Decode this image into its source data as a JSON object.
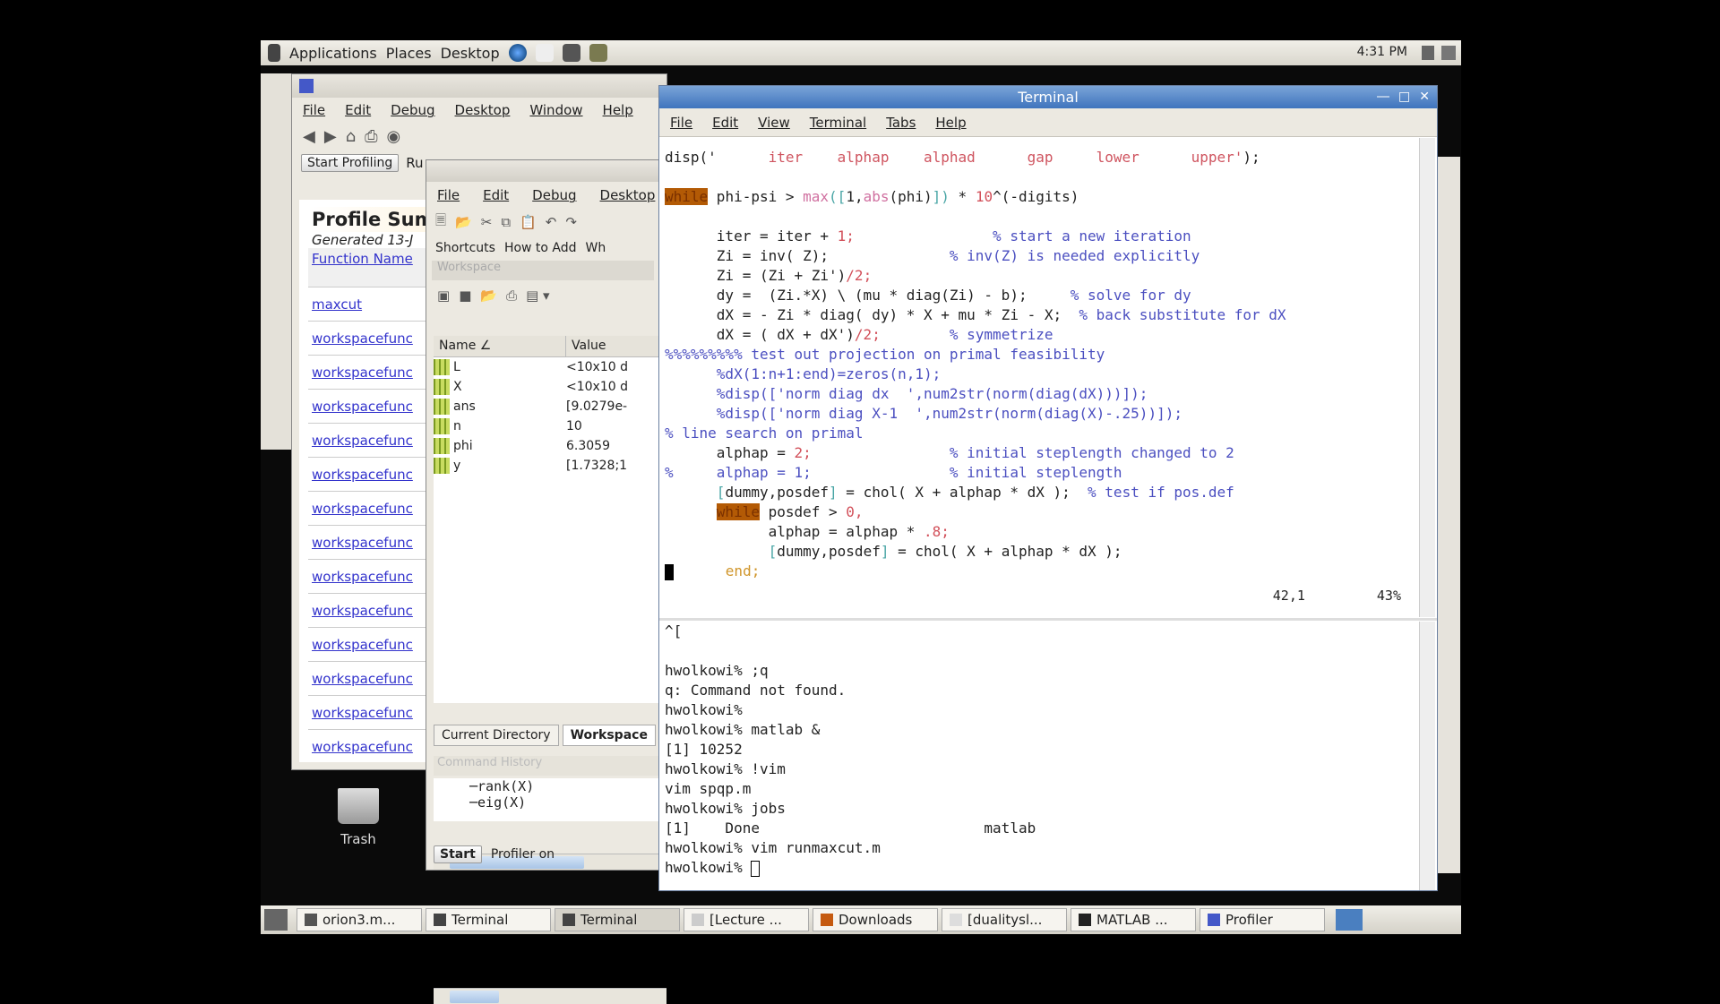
{
  "top_panel": {
    "menus": [
      "Applications",
      "Places",
      "Desktop"
    ],
    "clock": "4:31 PM"
  },
  "profiler": {
    "menu": [
      "File",
      "Edit",
      "Debug",
      "Desktop",
      "Window",
      "Help"
    ],
    "start_button": "Start Profiling",
    "run_label": "Ru",
    "heading": "Profile Sum",
    "generated": "Generated 13-J",
    "column_header": "Function Name",
    "links": [
      "maxcut",
      "workspacefunc",
      "workspacefunc",
      "workspacefunc",
      "workspacefunc",
      "workspacefunc",
      "workspacefunc",
      "workspacefunc",
      "workspacefunc",
      "workspacefunc",
      "workspacefunc",
      "workspacefunc",
      "workspacefunc",
      "workspacefunc"
    ]
  },
  "matlab": {
    "menu": [
      "File",
      "Edit",
      "Debug",
      "Desktop"
    ],
    "shortcuts": [
      "Shortcuts",
      "How to Add",
      "Wh"
    ],
    "workspace_title": "Workspace",
    "columns": [
      "Name ∠",
      "Value"
    ],
    "variables": [
      {
        "name": "L",
        "value": "<10x10 d"
      },
      {
        "name": "X",
        "value": "<10x10 d"
      },
      {
        "name": "ans",
        "value": "[9.0279e-"
      },
      {
        "name": "n",
        "value": "10"
      },
      {
        "name": "phi",
        "value": "6.3059"
      },
      {
        "name": "y",
        "value": "[1.7328;1"
      }
    ],
    "tabs": [
      "Current Directory",
      "Workspace"
    ],
    "history_title": "Command History",
    "history": [
      "─rank(X)",
      "─eig(X)"
    ],
    "start_label": "Start",
    "status": "Profiler on"
  },
  "terminal": {
    "title": "Terminal",
    "menu": [
      "File",
      "Edit",
      "View",
      "Terminal",
      "Tabs",
      "Help"
    ],
    "vim_lines": [
      [
        [
          "disp('      ",
          ""
        ],
        [
          "iter    alphap    alphad      gap     lower      upper'",
          "c-str"
        ],
        [
          ");",
          ""
        ]
      ],
      [],
      [
        [
          "while",
          "c-kw"
        ],
        [
          " phi-psi > ",
          ""
        ],
        [
          "max",
          "c-fn"
        ],
        [
          "([",
          "c-br"
        ],
        [
          "1,",
          ""
        ],
        [
          "abs",
          "c-fn"
        ],
        [
          "(phi)",
          ""
        ],
        [
          "])",
          "c-br"
        ],
        [
          " * ",
          ""
        ],
        [
          "10",
          "c-num"
        ],
        [
          "^(-digits)",
          ""
        ]
      ],
      [],
      [
        [
          "      iter = iter + ",
          ""
        ],
        [
          "1;",
          "c-num"
        ],
        [
          "                % start a new iteration",
          "c-cmt"
        ]
      ],
      [
        [
          "      Zi = inv( Z);              ",
          ""
        ],
        [
          "% inv(Z) is needed explicitly",
          "c-cmt"
        ]
      ],
      [
        [
          "      Zi = (Zi + Zi')",
          ""
        ],
        [
          "/2;",
          "c-num"
        ]
      ],
      [
        [
          "      dy =  (Zi.*X) \\ (mu * diag(Zi) - b);     ",
          ""
        ],
        [
          "% solve for dy",
          "c-cmt"
        ]
      ],
      [
        [
          "      dX = - Zi * diag( dy) * X + mu * Zi - X;  ",
          ""
        ],
        [
          "% back substitute for dX",
          "c-cmt"
        ]
      ],
      [
        [
          "      dX = ( dX + dX')",
          ""
        ],
        [
          "/2;",
          "c-num"
        ],
        [
          "        % symmetrize",
          "c-cmt"
        ]
      ],
      [
        [
          "%%%%%%%%% test out projection on primal feasibility",
          "c-cmt"
        ]
      ],
      [
        [
          "      %dX(1:n+1:end)=zeros(n,1);",
          "c-cmt"
        ]
      ],
      [
        [
          "      %disp(['norm diag dx  ',num2str(norm(diag(dX)))]);",
          "c-cmt"
        ]
      ],
      [
        [
          "      %disp(['norm diag X-1  ',num2str(norm(diag(X)-.25))]);",
          "c-cmt"
        ]
      ],
      [
        [
          "% line search on primal",
          "c-cmt"
        ]
      ],
      [
        [
          "      alphap = ",
          ""
        ],
        [
          "2;",
          "c-num"
        ],
        [
          "                % initial steplength changed to 2",
          "c-cmt"
        ]
      ],
      [
        [
          "%     alphap = 1;                % initial steplength",
          "c-cmt"
        ]
      ],
      [
        [
          "      ",
          ""
        ],
        [
          "[",
          "c-br"
        ],
        [
          "dummy,posdef",
          ""
        ],
        [
          "]",
          "c-br"
        ],
        [
          " = chol( X + alphap * dX );  ",
          ""
        ],
        [
          "% test if pos.def",
          "c-cmt"
        ]
      ],
      [
        [
          "      ",
          ""
        ],
        [
          "while",
          "c-kw"
        ],
        [
          " posdef > ",
          ""
        ],
        [
          "0,",
          "c-num"
        ]
      ],
      [
        [
          "            alphap = alphap * ",
          ""
        ],
        [
          ".8;",
          "c-num"
        ]
      ],
      [
        [
          "            ",
          ""
        ],
        [
          "[",
          "c-br"
        ],
        [
          "dummy,posdef",
          ""
        ],
        [
          "]",
          "c-br"
        ],
        [
          " = chol( X + alphap * dX );",
          ""
        ]
      ],
      [
        [
          "      ",
          ""
        ],
        [
          "end;",
          "c-end"
        ]
      ]
    ],
    "vim_position": "42,1",
    "vim_percent": "43%",
    "shell_lines": [
      "^[",
      "",
      "hwolkowi% ;q",
      "q: Command not found.",
      "hwolkowi%",
      "hwolkowi% matlab &",
      "[1] 10252",
      "hwolkowi% !vim",
      "vim spqp.m",
      "hwolkowi% jobs",
      "[1]    Done                          matlab",
      "hwolkowi% vim runmaxcut.m",
      "hwolkowi% "
    ]
  },
  "desktop": {
    "trash": "Trash"
  },
  "taskbar": [
    "orion3.m...",
    "Terminal",
    "Terminal",
    "[Lecture ...",
    "Downloads",
    "[dualitysl...",
    "MATLAB ...",
    "Profiler"
  ]
}
